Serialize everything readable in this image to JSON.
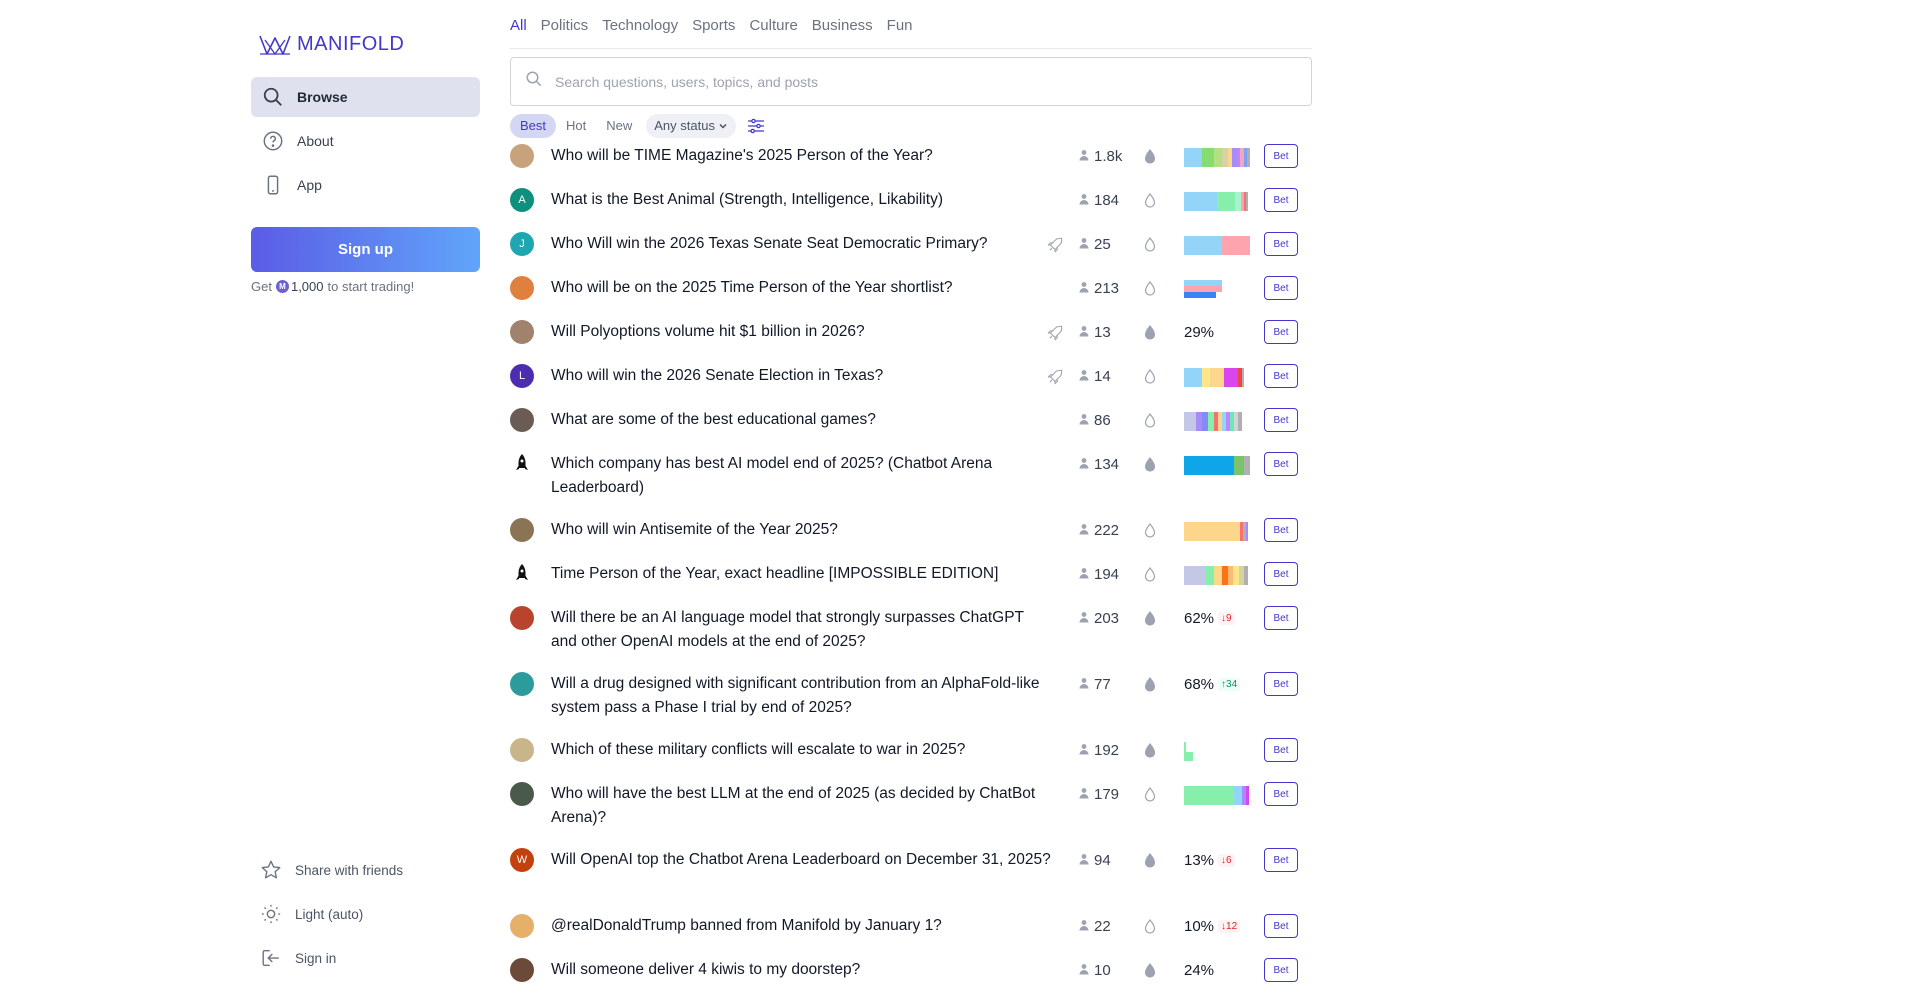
{
  "sidebar": {
    "logo_text": "MANIFOLD",
    "nav": [
      {
        "label": "Browse",
        "icon": "search-icon"
      },
      {
        "label": "About",
        "icon": "question-circle-icon"
      },
      {
        "label": "App",
        "icon": "phone-icon"
      }
    ],
    "signup_label": "Sign up",
    "promo": {
      "prefix": "Get",
      "amount": "1,000",
      "suffix": "to start trading!"
    },
    "footer": [
      {
        "label": "Share with friends",
        "icon": "star-icon"
      },
      {
        "label": "Light (auto)",
        "icon": "sun-icon"
      },
      {
        "label": "Sign in",
        "icon": "sign-in-icon"
      }
    ]
  },
  "topics": [
    "All",
    "Politics",
    "Technology",
    "Sports",
    "Culture",
    "Business",
    "Fun"
  ],
  "search": {
    "placeholder": "Search questions, users, topics, and posts"
  },
  "filters": {
    "sort": [
      "Best",
      "Hot",
      "New"
    ],
    "status": "Any status"
  },
  "colors": {
    "accent": "#4338ca",
    "signup_start": "#5b5ce6",
    "signup_end": "#60a5fa"
  },
  "markets": [
    {
      "question": "Who will be TIME Magazine's 2025 Person of the Year?",
      "traders": "1.8k",
      "bet_label": "Bet",
      "avatar": {
        "bg": "#c7a27a",
        "letter": ""
      },
      "multi": [
        [
          "#93d5f8",
          18
        ],
        [
          "#86dc6e",
          12
        ],
        [
          "#b4e081",
          8
        ],
        [
          "#d6d2a6",
          6
        ],
        [
          "#fcd68a",
          4
        ],
        [
          "#a78bfa",
          5
        ],
        [
          "#c084fc",
          3
        ],
        [
          "#f0a8c0",
          4
        ],
        [
          "#7fa1f1",
          3
        ],
        [
          "#b0b0b0",
          3
        ]
      ]
    },
    {
      "question": "What is the Best Animal (Strength, Intelligence, Likability)",
      "traders": "184",
      "bet_label": "Bet",
      "avatar": {
        "bg": "#0f8f7e",
        "letter": "A"
      },
      "multi": [
        [
          "#93d5f8",
          33
        ],
        [
          "#86efac",
          18
        ],
        [
          "#a7f3d0",
          6
        ],
        [
          "#fda4af",
          3
        ],
        [
          "#f87171",
          2
        ],
        [
          "#b0b0b0",
          2
        ]
      ]
    },
    {
      "question": "Who Will win the 2026 Texas Senate Seat Democratic Primary?",
      "traders": "25",
      "bet_label": "Bet",
      "boost": true,
      "avatar": {
        "bg": "#1ea7b0",
        "letter": "J"
      },
      "multi": [
        [
          "#93d5f8",
          38
        ],
        [
          "#fda4af",
          28
        ]
      ]
    },
    {
      "question": "Who will be on the 2025 Time Person of the Year shortlist?",
      "traders": "213",
      "bet_label": "Bet",
      "avatar": {
        "bg": "#e0803e",
        "letter": ""
      },
      "stacked": true
    },
    {
      "question": "Will Polyoptions volume hit $1 billion in 2026?",
      "traders": "13",
      "bet_label": "Bet",
      "boost": true,
      "avatar": {
        "bg": "#a0826d",
        "letter": ""
      },
      "prob": "29%"
    },
    {
      "question": "Who will win the 2026 Senate Election in Texas?",
      "traders": "14",
      "bet_label": "Bet",
      "boost": true,
      "avatar": {
        "bg": "#4c2db0",
        "letter": "L"
      },
      "multi": [
        [
          "#93d5f8",
          18
        ],
        [
          "#fde68a",
          8
        ],
        [
          "#fcd68a",
          14
        ],
        [
          "#d946ef",
          14
        ],
        [
          "#ef4444",
          4
        ],
        [
          "#b0b0b0",
          2
        ]
      ]
    },
    {
      "question": "What are some of the best educational games?",
      "traders": "86",
      "bet_label": "Bet",
      "avatar": {
        "bg": "#6b5b55",
        "letter": ""
      },
      "multi": [
        [
          "#c4c8e6",
          12
        ],
        [
          "#a78bfa",
          6
        ],
        [
          "#818cf8",
          6
        ],
        [
          "#86efac",
          6
        ],
        [
          "#f87171",
          4
        ],
        [
          "#fcd68a",
          4
        ],
        [
          "#93d5f8",
          4
        ],
        [
          "#c084fc",
          4
        ],
        [
          "#6ee7b7",
          4
        ],
        [
          "#d1d5db",
          4
        ],
        [
          "#b0b0b0",
          4
        ]
      ]
    },
    {
      "question": "Which company has best AI model end of 2025? (Chatbot Arena Leaderboard)",
      "traders": "134",
      "bet_label": "Bet",
      "avatar": {
        "bg": "#ffffff",
        "letter": ""
      },
      "multi": [
        [
          "#0ea5e9",
          50
        ],
        [
          "#7bc36a",
          10
        ],
        [
          "#b0b0b0",
          6
        ]
      ]
    },
    {
      "question": "Who will win Antisemite of the Year 2025?",
      "traders": "222",
      "bet_label": "Bet",
      "avatar": {
        "bg": "#8b7355",
        "letter": ""
      },
      "multi": [
        [
          "#fcd68a",
          56
        ],
        [
          "#f87171",
          3
        ],
        [
          "#b0b0b0",
          3
        ],
        [
          "#a78bfa",
          2
        ]
      ]
    },
    {
      "question": "Time Person of the Year, exact headline [IMPOSSIBLE EDITION]",
      "traders": "194",
      "bet_label": "Bet",
      "avatar": {
        "bg": "#ffffff",
        "letter": ""
      },
      "multi": [
        [
          "#c4c8e6",
          22
        ],
        [
          "#86efac",
          8
        ],
        [
          "#fcd68a",
          8
        ],
        [
          "#f97316",
          6
        ],
        [
          "#fdba74",
          5
        ],
        [
          "#fde68a",
          6
        ],
        [
          "#d6d2a6",
          5
        ],
        [
          "#b0b0b0",
          4
        ]
      ]
    },
    {
      "question": "Will there be an AI language model that strongly surpasses ChatGPT and other OpenAI models at the end of 2025?",
      "traders": "203",
      "bet_label": "Bet",
      "avatar": {
        "bg": "#b8442d",
        "letter": ""
      },
      "prob": "62%",
      "delta": {
        "dir": "down",
        "value": "9"
      }
    },
    {
      "question": "Will a drug designed with significant contribution from an AlphaFold-like system pass a Phase I trial by end of 2025?",
      "traders": "77",
      "bet_label": "Bet",
      "avatar": {
        "bg": "#2c9b9b",
        "letter": ""
      },
      "prob": "68%",
      "delta": {
        "dir": "up",
        "value": "34"
      }
    },
    {
      "question": "Which of these military conflicts will escalate to war in 2025?",
      "traders": "192",
      "bet_label": "Bet",
      "avatar": {
        "bg": "#c9b58a",
        "letter": ""
      },
      "tiny": true
    },
    {
      "question": "Who will have the best LLM at the end of 2025 (as decided by ChatBot Arena)?",
      "traders": "179",
      "bet_label": "Bet",
      "avatar": {
        "bg": "#4a5a4a",
        "letter": ""
      },
      "multi": [
        [
          "#86efac",
          50
        ],
        [
          "#93d5f8",
          8
        ],
        [
          "#a78bfa",
          4
        ],
        [
          "#d946ef",
          3
        ]
      ]
    },
    {
      "question": "Will OpenAI top the Chatbot Arena Leaderboard on December 31, 2025?",
      "traders": "94",
      "bet_label": "Bet",
      "avatar": {
        "bg": "#c2410c",
        "letter": "W"
      },
      "prob": "13%",
      "delta": {
        "dir": "down",
        "value": "6"
      }
    },
    {
      "question": "@realDonaldTrump banned from Manifold by January 1?",
      "traders": "22",
      "bet_label": "Bet",
      "avatar": {
        "bg": "#e5b06a",
        "letter": ""
      },
      "prob": "10%",
      "delta": {
        "dir": "down",
        "value": "12"
      }
    },
    {
      "question": "Will someone deliver 4 kiwis to my doorstep?",
      "traders": "10",
      "bet_label": "Bet",
      "avatar": {
        "bg": "#6b4a3a",
        "letter": ""
      },
      "prob": "24%"
    }
  ]
}
